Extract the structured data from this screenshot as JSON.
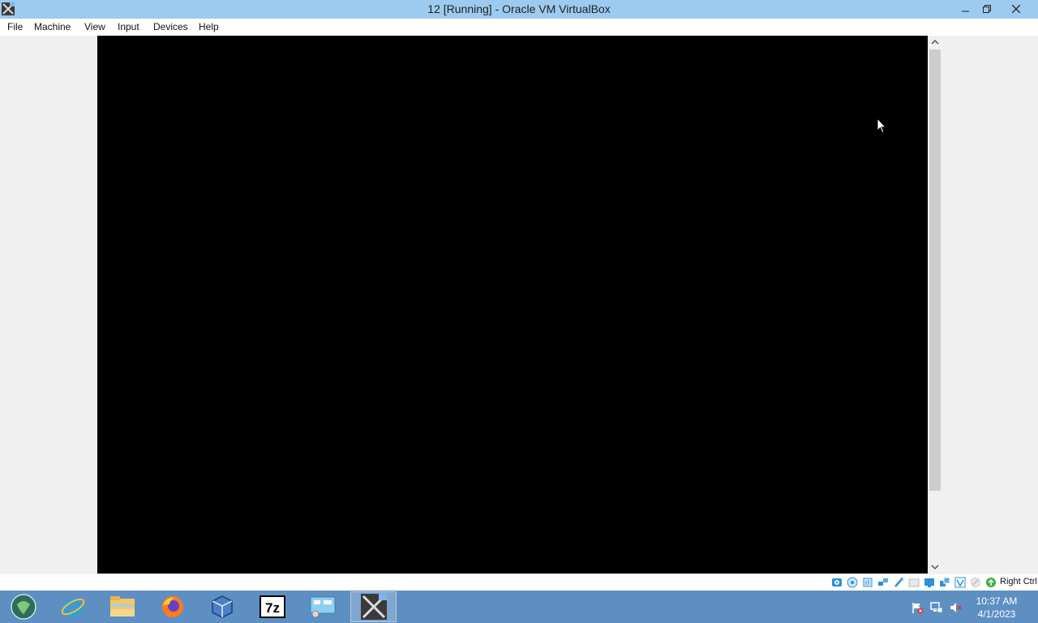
{
  "window": {
    "title": "12 [Running] - Oracle VM VirtualBox",
    "controls": [
      "minimize",
      "restore",
      "close"
    ]
  },
  "menubar": {
    "items": [
      "File",
      "Machine",
      "View",
      "Input",
      "Devices",
      "Help"
    ]
  },
  "statusbar": {
    "icons": [
      "hard-disk-icon",
      "optical-drive-icon",
      "audio-icon",
      "network-icon",
      "usb-icon",
      "shared-folders-icon",
      "display-icon",
      "recording-icon",
      "virtualization-icon",
      "mouse-integration-icon",
      "keyboard-icon"
    ],
    "host_key": "Right Ctrl"
  },
  "taskbar": {
    "apps": [
      "start-orb",
      "internet-explorer",
      "file-explorer",
      "firefox",
      "virtualbox",
      "7-zip",
      "control-panel",
      "virtualbox-vm"
    ],
    "clock": {
      "time": "10:37 AM",
      "date": "4/1/2023"
    },
    "tray": [
      "action-center-flag-icon",
      "network-icon",
      "volume-muted-icon"
    ]
  }
}
